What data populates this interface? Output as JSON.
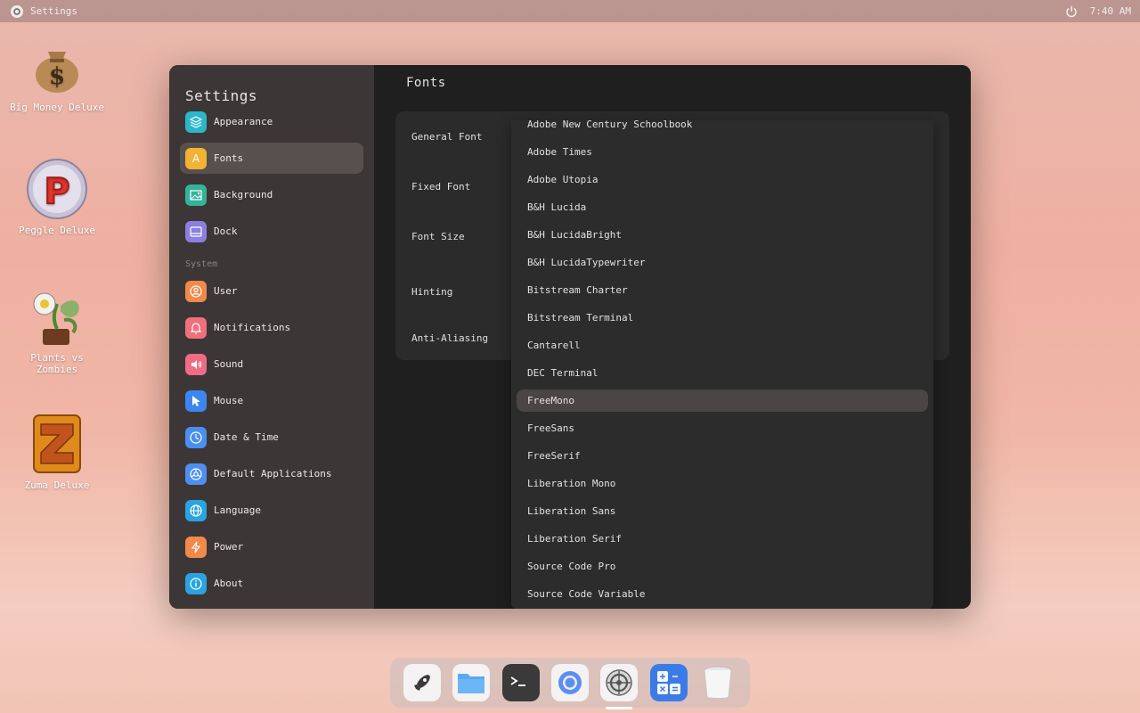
{
  "topbar": {
    "app_name": "Settings",
    "clock": "7:40 AM"
  },
  "desktop_icons": [
    {
      "label": "Big Money Deluxe"
    },
    {
      "label": "Peggle Deluxe"
    },
    {
      "label": "Plants vs Zombies"
    },
    {
      "label": "Zuma Deluxe"
    }
  ],
  "sidebar": {
    "title": "Settings",
    "items": [
      {
        "label": "Appearance",
        "icon": "layers-icon",
        "color": "#2bb6c9"
      },
      {
        "label": "Fonts",
        "icon": "font-icon",
        "color": "#f2b233"
      },
      {
        "label": "Background",
        "icon": "image-icon",
        "color": "#34b39a"
      },
      {
        "label": "Dock",
        "icon": "dock-icon",
        "color": "#8c7fe0"
      }
    ],
    "section_label": "System",
    "system_items": [
      {
        "label": "User",
        "icon": "user-icon",
        "color": "#f08a4b"
      },
      {
        "label": "Notifications",
        "icon": "bell-icon",
        "color": "#ef6f7d"
      },
      {
        "label": "Sound",
        "icon": "speaker-icon",
        "color": "#ee6d85"
      },
      {
        "label": "Mouse",
        "icon": "cursor-icon",
        "color": "#3d86f0"
      },
      {
        "label": "Date & Time",
        "icon": "clock-icon",
        "color": "#4a8ff0"
      },
      {
        "label": "Default Applications",
        "icon": "apps-icon",
        "color": "#4e8ef0"
      },
      {
        "label": "Language",
        "icon": "globe-icon",
        "color": "#2aa3e0"
      },
      {
        "label": "Power",
        "icon": "bolt-icon",
        "color": "#f08a4b"
      },
      {
        "label": "About",
        "icon": "info-icon",
        "color": "#2aa3e0"
      }
    ]
  },
  "main": {
    "title": "Fonts",
    "settings": [
      {
        "label": "General Font"
      },
      {
        "label": "Fixed Font"
      },
      {
        "label": "Font Size"
      },
      {
        "label": "Hinting"
      },
      {
        "label": "Anti-Aliasing"
      }
    ]
  },
  "dropdown": {
    "options": [
      "Adobe New Century Schoolbook",
      "Adobe Times",
      "Adobe Utopia",
      "B&H Lucida",
      "B&H LucidaBright",
      "B&H LucidaTypewriter",
      "Bitstream Charter",
      "Bitstream Terminal",
      "Cantarell",
      "DEC Terminal",
      "FreeMono",
      "FreeSans",
      "FreeSerif",
      "Liberation Mono",
      "Liberation Sans",
      "Liberation Serif",
      "Source Code Pro",
      "Source Code Variable"
    ],
    "selected": "FreeMono"
  },
  "dock": {
    "items": [
      "launcher-icon",
      "files-icon",
      "terminal-icon",
      "browser-icon",
      "settings-icon",
      "calculator-icon",
      "trash-icon"
    ]
  }
}
